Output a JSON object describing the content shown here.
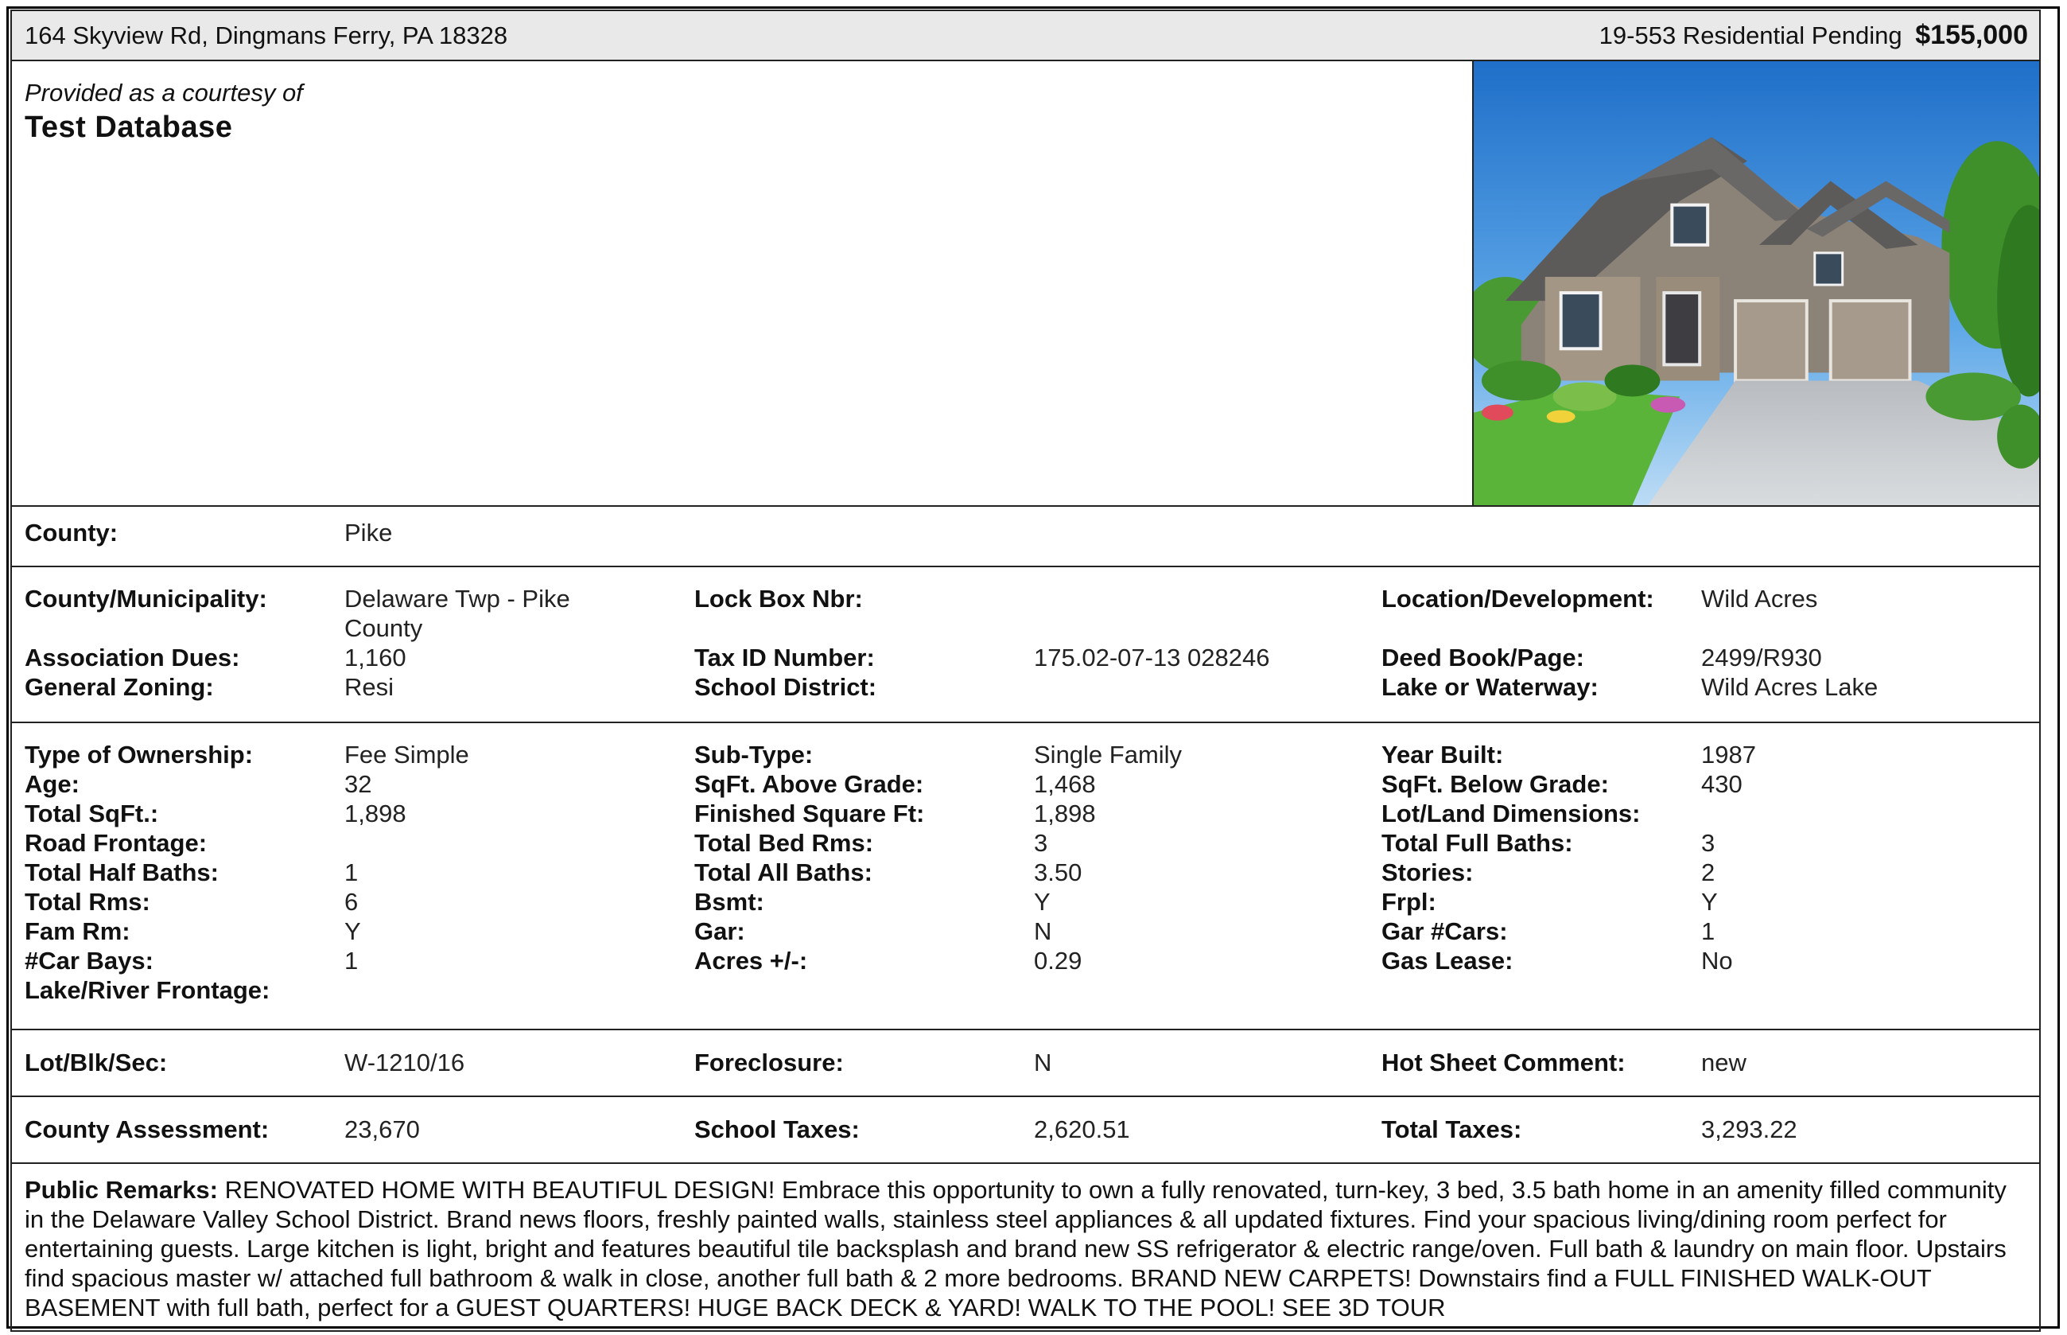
{
  "header": {
    "address": "164 Skyview Rd, Dingmans Ferry, PA 18328",
    "listing_info": "19-553 Residential Pending",
    "price": "$155,000"
  },
  "courtesy": {
    "line1": "Provided as a courtesy of",
    "name": "Test Database"
  },
  "photo": {
    "alt": "house-photo"
  },
  "county": {
    "label": "County:",
    "value": "Pike"
  },
  "block1": {
    "r1": {
      "l1": "County/Municipality:",
      "v1": "Delaware Twp - Pike County",
      "l2": "Lock Box Nbr:",
      "v2": "",
      "l3": "Location/Development:",
      "v3": "Wild Acres"
    },
    "r2": {
      "l1": "Association Dues:",
      "v1": "1,160",
      "l2": "Tax ID Number:",
      "v2": "175.02-07-13 028246",
      "l3": "Deed Book/Page:",
      "v3": "2499/R930"
    },
    "r3": {
      "l1": "General Zoning:",
      "v1": "Resi",
      "l2": "School District:",
      "v2": "",
      "l3": "Lake or Waterway:",
      "v3": "Wild Acres Lake"
    }
  },
  "block2": {
    "r1": {
      "l1": "Type of Ownership:",
      "v1": "Fee Simple",
      "l2": "Sub-Type:",
      "v2": "Single Family",
      "l3": "Year Built:",
      "v3": "1987"
    },
    "r2": {
      "l1": "Age:",
      "v1": "32",
      "l2": "SqFt. Above Grade:",
      "v2": "1,468",
      "l3": "SqFt. Below Grade:",
      "v3": "430"
    },
    "r3": {
      "l1": "Total SqFt.:",
      "v1": "1,898",
      "l2": "Finished Square Ft:",
      "v2": "1,898",
      "l3": "Lot/Land Dimensions:",
      "v3": ""
    },
    "r4": {
      "l1": "Road Frontage:",
      "v1": "",
      "l2": "Total Bed Rms:",
      "v2": "3",
      "l3": "Total Full Baths:",
      "v3": "3"
    },
    "r5": {
      "l1": "Total Half Baths:",
      "v1": "1",
      "l2": "Total All Baths:",
      "v2": "3.50",
      "l3": "Stories:",
      "v3": "2"
    },
    "r6": {
      "l1": "Total Rms:",
      "v1": "6",
      "l2": "Bsmt:",
      "v2": "Y",
      "l3": "Frpl:",
      "v3": "Y"
    },
    "r7": {
      "l1": "Fam Rm:",
      "v1": "Y",
      "l2": "Gar:",
      "v2": "N",
      "l3": "Gar #Cars:",
      "v3": "1"
    },
    "r8": {
      "l1": "#Car Bays:",
      "v1": "1",
      "l2": "Acres +/-:",
      "v2": "0.29",
      "l3": "Gas Lease:",
      "v3": "No"
    },
    "r9": {
      "l1": "Lake/River Frontage:",
      "v1": "",
      "l2": "",
      "v2": "",
      "l3": "",
      "v3": ""
    }
  },
  "block3": {
    "l1": "Lot/Blk/Sec:",
    "v1": "W-1210/16",
    "l2": "Foreclosure:",
    "v2": "N",
    "l3": "Hot Sheet Comment:",
    "v3": "new"
  },
  "block4": {
    "l1": "County Assessment:",
    "v1": "23,670",
    "l2": "School Taxes:",
    "v2": "2,620.51",
    "l3": "Total Taxes:",
    "v3": "3,293.22"
  },
  "remarks": {
    "label": "Public Remarks:",
    "text": "RENOVATED HOME WITH BEAUTIFUL DESIGN! Embrace this opportunity to own a fully renovated, turn-key, 3 bed, 3.5 bath home in an amenity filled community in the Delaware Valley School District. Brand news floors, freshly painted walls, stainless steel appliances & all updated fixtures. Find your spacious living/dining room perfect for entertaining guests. Large kitchen is light, bright and features beautiful tile backsplash and brand new SS refrigerator & electric range/oven. Full bath & laundry on main floor. Upstairs find spacious master w/ attached full bathroom & walk in close, another full bath & 2 more bedrooms. BRAND NEW CARPETS! Downstairs find a FULL FINISHED WALK-OUT BASEMENT with full bath, perfect for a GUEST QUARTERS! HUGE BACK DECK & YARD! WALK TO THE POOL! SEE 3D TOUR"
  }
}
